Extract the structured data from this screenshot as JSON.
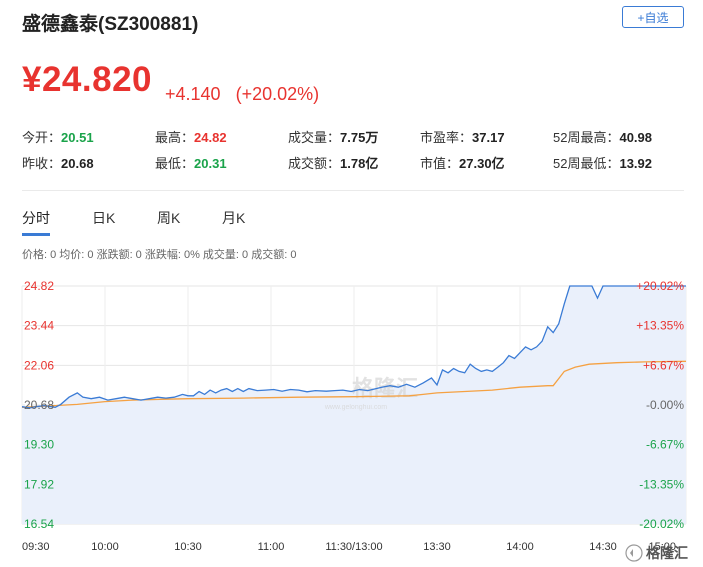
{
  "stock": {
    "name_code": "盛德鑫泰(SZ300881)",
    "add_label": "+自选",
    "price": "¥24.820",
    "change": "+4.140",
    "change_pct": "(+20.02%)"
  },
  "stats": [
    {
      "label": "今开：",
      "value": "20.51",
      "color": "down"
    },
    {
      "label": "最高：",
      "value": "24.82",
      "color": "up"
    },
    {
      "label": "成交量：",
      "value": "7.75万",
      "color": "dark"
    },
    {
      "label": "市盈率：",
      "value": "37.17",
      "color": "dark"
    },
    {
      "label": "52周最高：",
      "value": "40.98",
      "color": "dark"
    },
    {
      "label": "昨收：",
      "value": "20.68",
      "color": "dark"
    },
    {
      "label": "最低：",
      "value": "20.31",
      "color": "down"
    },
    {
      "label": "成交额：",
      "value": "1.78亿",
      "color": "dark"
    },
    {
      "label": "市值：",
      "value": "27.30亿",
      "color": "dark"
    },
    {
      "label": "52周最低：",
      "value": "13.92",
      "color": "dark"
    }
  ],
  "tabs": [
    "分时",
    "日K",
    "周K",
    "月K"
  ],
  "infoline": "价格: 0  均价: 0  涨跌额: 0  涨跌幅: 0%  成交量: 0  成交额: 0",
  "watermark": "格隆汇",
  "watermark_url": "www.gelonghui.com",
  "corner_logo": "格隆汇",
  "colors": {
    "up": "#e8332f",
    "down": "#1aa34a",
    "price_line": "#3a7bd5",
    "avg_line": "#f5a142",
    "fill": "#eaf0fb"
  },
  "chart_data": {
    "type": "line",
    "y_left_ticks": [
      "24.82",
      "23.44",
      "22.06",
      "20.68",
      "19.30",
      "17.92",
      "16.54"
    ],
    "y_right_ticks": [
      "+20.02%",
      "+13.35%",
      "+6.67%",
      "-0.00%",
      "-6.67%",
      "-13.35%",
      "-20.02%"
    ],
    "ylim": [
      16.54,
      24.82
    ],
    "prev_close": 20.68,
    "x_ticks": [
      "09:30",
      "10:00",
      "10:30",
      "11:00",
      "11:30/13:00",
      "13:30",
      "14:00",
      "14:30",
      "15:00"
    ],
    "xlim": [
      0,
      240
    ],
    "series": [
      {
        "role": "price",
        "points": [
          [
            0,
            20.62
          ],
          [
            3,
            20.58
          ],
          [
            5,
            20.62
          ],
          [
            8,
            20.66
          ],
          [
            12,
            20.6
          ],
          [
            14,
            20.7
          ],
          [
            17,
            20.95
          ],
          [
            20,
            21.1
          ],
          [
            22,
            20.95
          ],
          [
            25,
            20.9
          ],
          [
            28,
            20.95
          ],
          [
            31,
            20.85
          ],
          [
            34,
            20.9
          ],
          [
            37,
            20.95
          ],
          [
            40,
            20.9
          ],
          [
            43,
            20.85
          ],
          [
            46,
            20.9
          ],
          [
            49,
            20.95
          ],
          [
            52,
            20.92
          ],
          [
            55,
            20.95
          ],
          [
            58,
            21.05
          ],
          [
            60,
            21.0
          ],
          [
            62,
            21.0
          ],
          [
            64,
            21.15
          ],
          [
            66,
            21.05
          ],
          [
            68,
            21.2
          ],
          [
            70,
            21.1
          ],
          [
            72,
            21.2
          ],
          [
            74,
            21.25
          ],
          [
            76,
            21.15
          ],
          [
            78,
            21.25
          ],
          [
            80,
            21.15
          ],
          [
            82,
            21.25
          ],
          [
            85,
            21.18
          ],
          [
            88,
            21.2
          ],
          [
            91,
            21.22
          ],
          [
            94,
            21.16
          ],
          [
            97,
            21.22
          ],
          [
            100,
            21.2
          ],
          [
            103,
            21.14
          ],
          [
            106,
            21.18
          ],
          [
            110,
            21.16
          ],
          [
            113,
            21.18
          ],
          [
            116,
            21.2
          ],
          [
            119,
            21.15
          ],
          [
            122,
            21.22
          ],
          [
            125,
            21.18
          ],
          [
            128,
            21.25
          ],
          [
            130,
            21.3
          ],
          [
            133,
            21.35
          ],
          [
            136,
            21.3
          ],
          [
            139,
            21.4
          ],
          [
            142,
            21.3
          ],
          [
            145,
            21.45
          ],
          [
            148,
            21.62
          ],
          [
            150,
            21.38
          ],
          [
            152,
            21.9
          ],
          [
            154,
            21.8
          ],
          [
            156,
            21.95
          ],
          [
            158,
            21.85
          ],
          [
            160,
            21.8
          ],
          [
            162,
            22.1
          ],
          [
            164,
            21.95
          ],
          [
            166,
            21.85
          ],
          [
            168,
            21.9
          ],
          [
            170,
            21.85
          ],
          [
            172,
            22.0
          ],
          [
            174,
            22.15
          ],
          [
            176,
            22.4
          ],
          [
            178,
            22.3
          ],
          [
            180,
            22.5
          ],
          [
            182,
            22.7
          ],
          [
            184,
            22.6
          ],
          [
            186,
            22.7
          ],
          [
            188,
            22.9
          ],
          [
            190,
            23.4
          ],
          [
            192,
            23.2
          ],
          [
            194,
            23.5
          ],
          [
            196,
            24.2
          ],
          [
            198,
            24.82
          ],
          [
            204,
            24.82
          ],
          [
            206,
            24.82
          ],
          [
            208,
            24.4
          ],
          [
            210,
            24.82
          ],
          [
            212,
            24.82
          ],
          [
            240,
            24.82
          ]
        ]
      },
      {
        "role": "avg",
        "points": [
          [
            0,
            20.6
          ],
          [
            10,
            20.65
          ],
          [
            20,
            20.7
          ],
          [
            30,
            20.8
          ],
          [
            40,
            20.85
          ],
          [
            50,
            20.88
          ],
          [
            60,
            20.9
          ],
          [
            80,
            20.92
          ],
          [
            100,
            20.95
          ],
          [
            120,
            20.97
          ],
          [
            140,
            21.0
          ],
          [
            145,
            21.05
          ],
          [
            150,
            21.1
          ],
          [
            160,
            21.15
          ],
          [
            170,
            21.2
          ],
          [
            180,
            21.3
          ],
          [
            190,
            21.35
          ],
          [
            192,
            21.35
          ],
          [
            194,
            21.6
          ],
          [
            196,
            21.85
          ],
          [
            200,
            22.0
          ],
          [
            205,
            22.1
          ],
          [
            215,
            22.15
          ],
          [
            225,
            22.18
          ],
          [
            240,
            22.2
          ]
        ]
      }
    ]
  }
}
